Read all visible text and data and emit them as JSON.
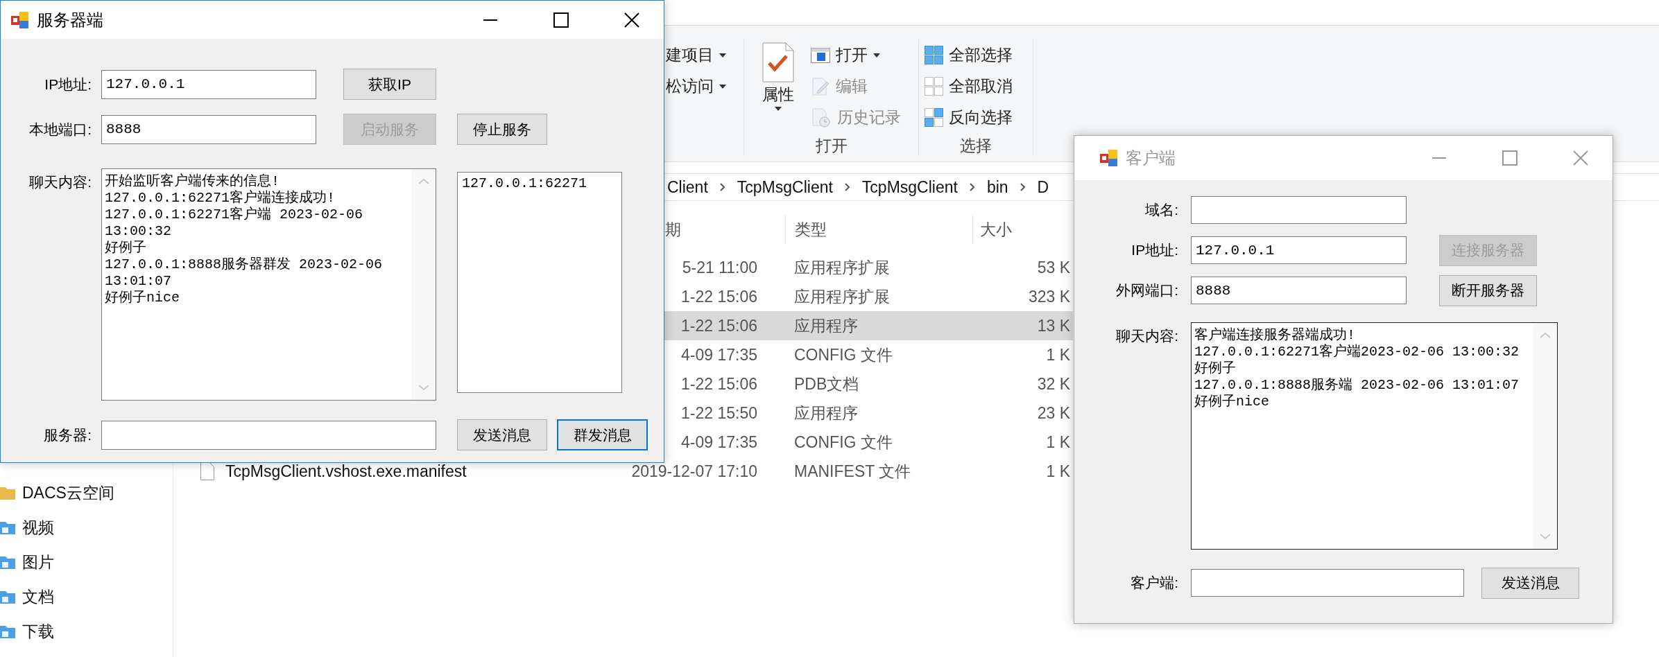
{
  "explorer": {
    "ribbon": [
      {
        "items": [
          {
            "label": "建项目",
            "dropdown": true,
            "disabled": false
          },
          {
            "label": "松访问",
            "dropdown": true,
            "disabled": false
          }
        ]
      },
      {
        "label": "打开",
        "large": {
          "label": "属性",
          "dropdown": true
        },
        "items": [
          {
            "label": "打开",
            "dropdown": true,
            "disabled": false
          },
          {
            "label": "编辑",
            "dropdown": false,
            "disabled": true
          },
          {
            "label": "历史记录",
            "dropdown": false,
            "disabled": true
          }
        ]
      },
      {
        "label": "选择",
        "items": [
          {
            "label": "全部选择",
            "dropdown": false,
            "disabled": false
          },
          {
            "label": "全部取消",
            "dropdown": false,
            "disabled": false
          },
          {
            "label": "反向选择",
            "dropdown": false,
            "disabled": false
          }
        ]
      }
    ],
    "breadcrumb": [
      "Client",
      "TcpMsgClient",
      "TcpMsgClient",
      "bin",
      "D"
    ],
    "columns": [
      "期",
      "类型",
      "大小"
    ],
    "files": [
      {
        "date": "5-21 11:00",
        "type": "应用程序扩展",
        "size": "53 K",
        "selected": false
      },
      {
        "date": "1-22 15:06",
        "type": "应用程序扩展",
        "size": "323 K",
        "selected": false
      },
      {
        "date": "1-22 15:06",
        "type": "应用程序",
        "size": "13 K",
        "selected": true
      },
      {
        "date": "4-09 17:35",
        "type": "CONFIG 文件",
        "size": "1 K",
        "selected": false
      },
      {
        "date": "1-22 15:06",
        "type": "PDB文档",
        "size": "32 K",
        "selected": false
      },
      {
        "date": "1-22 15:50",
        "type": "应用程序",
        "size": "23 K",
        "selected": false
      },
      {
        "date": "4-09 17:35",
        "type": "CONFIG 文件",
        "size": "1 K",
        "selected": false
      },
      {
        "name": "TcpMsgClient.vshost.exe.manifest",
        "date": "2019-12-07 17:10",
        "type": "MANIFEST 文件",
        "size": "1 K",
        "selected": false
      }
    ],
    "nav": [
      "DACS云空间",
      "视频",
      "图片",
      "文档",
      "下载"
    ]
  },
  "server": {
    "title": "服务器端",
    "active": true,
    "ip": {
      "label": "IP地址:",
      "value": "127.0.0.1"
    },
    "port": {
      "label": "本地端口:",
      "value": "8888"
    },
    "chat": {
      "label": "聊天内容:",
      "lines": [
        "开始监听客户端传来的信息!",
        "127.0.0.1:62271客户端连接成功!",
        "127.0.0.1:62271客户端 2023-02-06",
        "13:00:32",
        "好例子",
        "127.0.0.1:8888服务器群发 2023-02-06",
        "13:01:07",
        "好例子nice"
      ]
    },
    "clients": [
      {
        "text": "127.0.0.1:62271",
        "selected": false
      }
    ],
    "message": {
      "label": "服务器:"
    },
    "buttons": [
      {
        "label": "获取IP",
        "disabled": false,
        "focused": false
      },
      {
        "label": "启动服务",
        "disabled": true,
        "focused": false
      },
      {
        "label": "停止服务",
        "disabled": false,
        "focused": false
      },
      {
        "label": "发送消息",
        "disabled": false,
        "focused": false
      },
      {
        "label": "群发消息",
        "disabled": false,
        "focused": true
      }
    ]
  },
  "client": {
    "title": "客户端",
    "active": false,
    "domain": {
      "label": "域名:"
    },
    "ip": {
      "label": "IP地址:",
      "value": "127.0.0.1"
    },
    "port": {
      "label": "外网端口:",
      "value": "8888"
    },
    "chat": {
      "label": "聊天内容:",
      "lines": [
        "客户端连接服务器端成功!",
        "127.0.0.1:62271客户端2023-02-06 13:00:32",
        "好例子",
        "127.0.0.1:8888服务端 2023-02-06 13:01:07",
        "好例子nice"
      ]
    },
    "message": {
      "label": "客户端:"
    },
    "buttons": [
      {
        "label": "连接服务器",
        "disabled": true,
        "focused": false
      },
      {
        "label": "断开服务器",
        "disabled": false,
        "focused": false
      },
      {
        "label": "发送消息",
        "disabled": false,
        "focused": false
      }
    ]
  }
}
